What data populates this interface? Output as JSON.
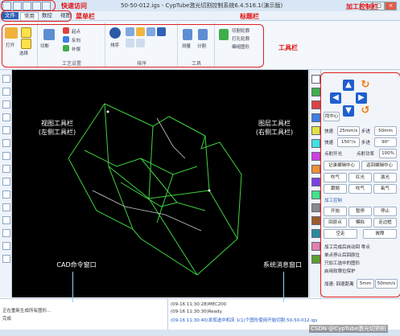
{
  "window": {
    "title": "50-50-012.igs - CypTube激光切割控制系统6.4.516.1(演示版)"
  },
  "tabs": [
    {
      "label": "文件"
    },
    {
      "label": "常用"
    },
    {
      "label": "数控"
    },
    {
      "label": "视图"
    }
  ],
  "ribbon": {
    "groups": [
      {
        "label": ""
      },
      {
        "label": "工艺设置"
      },
      {
        "label": "排序"
      },
      {
        "label": "工具"
      },
      {
        "label": ""
      }
    ],
    "items": {
      "open": "打开",
      "select": "选择",
      "lead": "起点",
      "reverse": "反向",
      "cut_start": "切断",
      "compensation": "补偿",
      "sort": "排序",
      "measure": "测量",
      "slice": "分割",
      "cut_contour": "切割轮廓",
      "pierce_contour": "打孔轮廓",
      "group_contour": "编组图形"
    }
  },
  "panel": {
    "title": "加工控制",
    "speed_label": "快速",
    "speed_value": "25mm/s",
    "step_label": "步进",
    "step_value": "50mm",
    "speed2_label": "快速",
    "speed2_value": "150°/s",
    "step2_value": "90°",
    "find_center": "找中心",
    "auto_focus": "点射开光",
    "power_label": "点射功率",
    "power_value": "100%",
    "chuck_center_a": "记录编辑中心",
    "chuck_center_b": "返回编辑中心",
    "gas": [
      "吹气",
      "红光",
      "激光",
      "跟随",
      "吹气",
      "氧气"
    ],
    "machining": "加工控制",
    "start": "开始",
    "pause": "暂停",
    "stop": "停止",
    "back": "回原点",
    "sim": "模拟",
    "frame": "走边框",
    "air": "空走",
    "reset": "故障",
    "check_a": "加工完成后自动回 零点",
    "check_b": "单点停止后回原位",
    "check_c": "只加工选中的图形",
    "check_d": "启用软限位保护",
    "mode_label": "加速: 回退距离",
    "mode_value": "5mm",
    "mode_value2": "50mm/s"
  },
  "cmd_pane": {
    "lines": [
      "正在重新生成所有图形...",
      "完成"
    ]
  },
  "msg_pane": {
    "lines": [
      "(09-16 11:30:28)MEC200",
      "(09-16 11:30:30)Ready.",
      "(09-16 11:30:40)发现选中机床 1(1)个图形使用开始切割:50-50-012.igs"
    ]
  },
  "annotations": {
    "quick_access": "快速访问",
    "menu_bar": "菜单栏",
    "title_bar": "标题栏",
    "toolbar": "工具栏",
    "control_panel": "加工控制栏",
    "view_toolbar_1": "视图工具栏",
    "view_toolbar_2": "(左侧工具栏)",
    "layer_toolbar_1": "图层工具栏",
    "layer_toolbar_2": "(右侧工具栏)",
    "cad_cmd": "CAD命令窗口",
    "sys_msg": "系统消息窗口",
    "watermark": "CSDN @CypTube激光切割机"
  },
  "colors": {
    "accent": "#2e62b5",
    "annotation": "#e01010",
    "canvas": "#000000",
    "part": "#3fd23f"
  }
}
